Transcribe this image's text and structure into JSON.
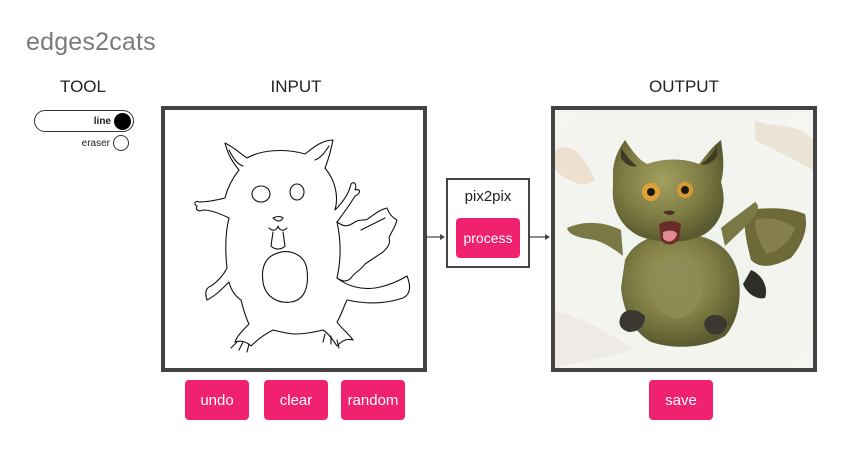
{
  "app": {
    "title": "edges2cats"
  },
  "headings": {
    "tool": "TOOL",
    "input": "INPUT",
    "output": "OUTPUT"
  },
  "tool": {
    "options": [
      {
        "label": "line",
        "selected": true
      },
      {
        "label": "eraser",
        "selected": false
      }
    ]
  },
  "model": {
    "name": "pix2pix",
    "process_label": "process"
  },
  "input_actions": {
    "undo": "undo",
    "clear": "clear",
    "random": "random"
  },
  "output_actions": {
    "save": "save"
  },
  "colors": {
    "accent": "#f0216e",
    "frame": "#444444",
    "title": "#7a7a7a"
  }
}
